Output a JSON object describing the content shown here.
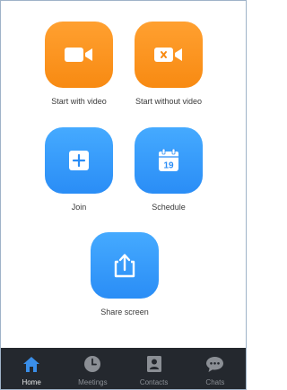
{
  "actions": {
    "start_with_video": {
      "label": "Start with video",
      "icon": "video-camera-icon"
    },
    "start_without_video": {
      "label": "Start without video",
      "icon": "video-off-icon"
    },
    "join": {
      "label": "Join",
      "icon": "plus-icon"
    },
    "schedule": {
      "label": "Schedule",
      "icon": "calendar-icon",
      "calendar_day": "19"
    },
    "share_screen": {
      "label": "Share screen",
      "icon": "share-upload-icon"
    }
  },
  "nav": {
    "home": {
      "label": "Home",
      "icon": "home-icon",
      "active": true
    },
    "meetings": {
      "label": "Meetings",
      "icon": "clock-icon"
    },
    "contacts": {
      "label": "Contacts",
      "icon": "contacts-icon"
    },
    "chats": {
      "label": "Chats",
      "icon": "chat-bubble-icon"
    }
  },
  "colors": {
    "orange": "#f88a12",
    "blue": "#2a8df6",
    "bar_background": "#24282e",
    "nav_active": "#3a8ee8",
    "nav_inactive": "#8b8f95"
  }
}
